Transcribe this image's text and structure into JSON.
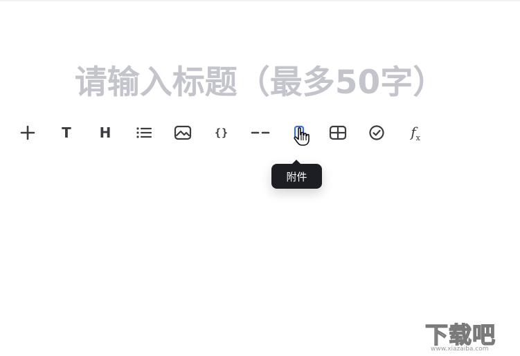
{
  "editor": {
    "title_placeholder": "请输入标题（最多50字）"
  },
  "toolbar": {
    "items": [
      {
        "name": "add",
        "icon": "plus-icon"
      },
      {
        "name": "text",
        "icon": "text-icon",
        "glyph": "T"
      },
      {
        "name": "heading",
        "icon": "heading-icon",
        "glyph": "H"
      },
      {
        "name": "list",
        "icon": "list-icon"
      },
      {
        "name": "image",
        "icon": "image-icon"
      },
      {
        "name": "code",
        "icon": "code-braces-icon",
        "glyph": "{}"
      },
      {
        "name": "divider",
        "icon": "divider-icon"
      },
      {
        "name": "attachment",
        "icon": "attachment-icon"
      },
      {
        "name": "table",
        "icon": "table-icon"
      },
      {
        "name": "todo",
        "icon": "check-circle-icon"
      },
      {
        "name": "formula",
        "icon": "formula-icon",
        "glyph": "f",
        "glyph_sub": "x"
      }
    ],
    "hovered": "attachment"
  },
  "tooltip": {
    "label": "附件"
  },
  "watermark": {
    "text": "下载吧",
    "url": "www.xiazaiba.com"
  },
  "colors": {
    "placeholder": "#c4c5cc",
    "icon": "#3b3c40",
    "tooltip_bg": "#1d1d24",
    "attachment_accent": "#3b72d8"
  }
}
